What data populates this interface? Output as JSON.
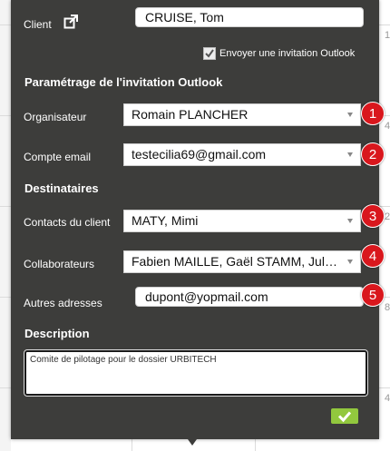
{
  "background": {
    "side_numbers": [
      "1",
      "4",
      "2",
      "8",
      "4"
    ]
  },
  "form": {
    "client_label": "Client",
    "client_value": "CRUISE, Tom",
    "invite_checkbox_label": "Envoyer une invitation Outlook",
    "invite_checked": true,
    "settings_title": "Paramétrage de l'invitation Outlook",
    "organizer_label": "Organisateur",
    "organizer_value": "Romain PLANCHER",
    "email_account_label": "Compte email",
    "email_account_value": "testecilia69@gmail.com",
    "recipients_title": "Destinataires",
    "client_contacts_label": "Contacts du client",
    "client_contacts_value": "MATY, Mimi",
    "collaborators_label": "Collaborateurs",
    "collaborators_value": "Fabien MAILLE, Gaël STAMM, Julien...",
    "other_addresses_label": "Autres adresses",
    "other_addresses_value": "dupont@yopmail.com",
    "description_title": "Description",
    "description_value": "Comite de pilotage pour le dossier URBITECH"
  },
  "badges": [
    "1",
    "2",
    "3",
    "4",
    "5"
  ],
  "colors": {
    "popup_bg": "#3d3d3b",
    "badge_red": "#d9171d",
    "ok_green": "#92c83e"
  },
  "icons": {
    "client_link": "external-link-icon",
    "ok": "checkmark-icon"
  }
}
